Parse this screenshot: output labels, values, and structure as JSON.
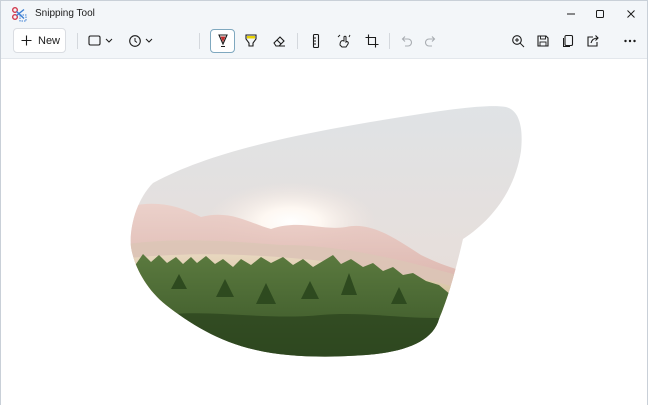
{
  "window": {
    "title": "Snipping Tool"
  },
  "toolbar": {
    "new_label": "New",
    "tools": [
      {
        "name": "snip-mode",
        "icon": "rectangle-icon"
      },
      {
        "name": "delay",
        "icon": "clock-icon"
      },
      {
        "name": "ballpoint-pen",
        "icon": "pen-icon",
        "color": "#c22a2a",
        "selected": true
      },
      {
        "name": "highlighter",
        "icon": "highlighter-icon",
        "color": "#e8d300"
      },
      {
        "name": "eraser",
        "icon": "eraser-icon"
      },
      {
        "name": "ruler",
        "icon": "ruler-icon"
      },
      {
        "name": "touch-writing",
        "icon": "touch-writing-icon"
      },
      {
        "name": "crop",
        "icon": "crop-icon"
      },
      {
        "name": "undo",
        "icon": "undo-icon",
        "disabled": true
      },
      {
        "name": "redo",
        "icon": "redo-icon",
        "disabled": true
      },
      {
        "name": "zoom",
        "icon": "zoom-in-icon"
      },
      {
        "name": "save",
        "icon": "save-icon"
      },
      {
        "name": "copy",
        "icon": "copy-icon"
      },
      {
        "name": "share",
        "icon": "share-icon"
      },
      {
        "name": "see-more",
        "icon": "more-icon"
      }
    ]
  },
  "colors": {
    "titlebar_bg": "#f3f6f9",
    "accent": "#7fa8bf",
    "pen_red": "#c22a2a",
    "highlighter_yellow": "#e8d300"
  },
  "snip": {
    "content": "freeform snip of a sunlit hazy mountain range above a pine forest"
  }
}
